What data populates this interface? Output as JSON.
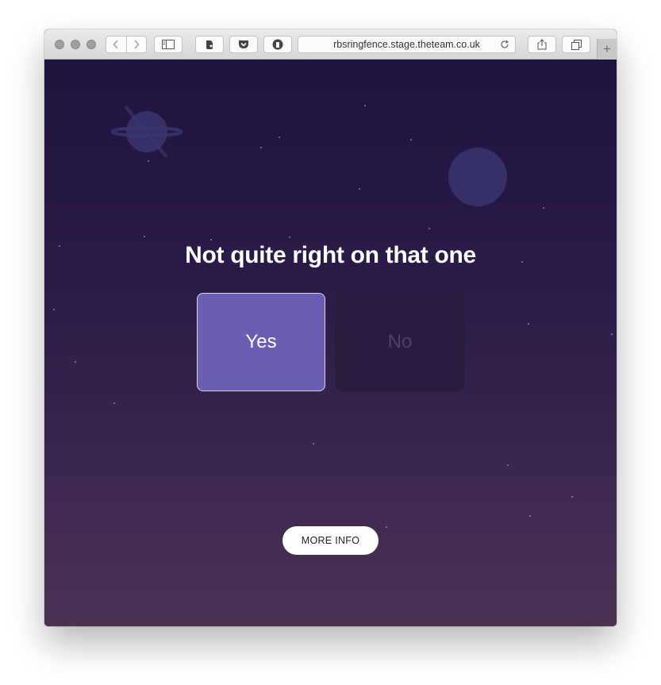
{
  "browser": {
    "url": "rbsringfence.stage.theteam.co.uk",
    "new_tab_label": "+"
  },
  "page": {
    "heading": "Not quite right on that one",
    "yes_label": "Yes",
    "no_label": "No",
    "more_info_label": "MORE INFO"
  },
  "icons": [
    "back-icon",
    "forward-icon",
    "sidebar-icon",
    "evernote-icon",
    "pocket-icon",
    "privacy-icon",
    "reload-icon",
    "share-icon",
    "tabs-icon",
    "planet-icon",
    "moon-icon"
  ],
  "colors": {
    "bg_top": "#1f1440",
    "bg_bottom": "#4b3253",
    "yes_bg": "#6b5eb2",
    "no_bg": "#2a1c3e"
  }
}
